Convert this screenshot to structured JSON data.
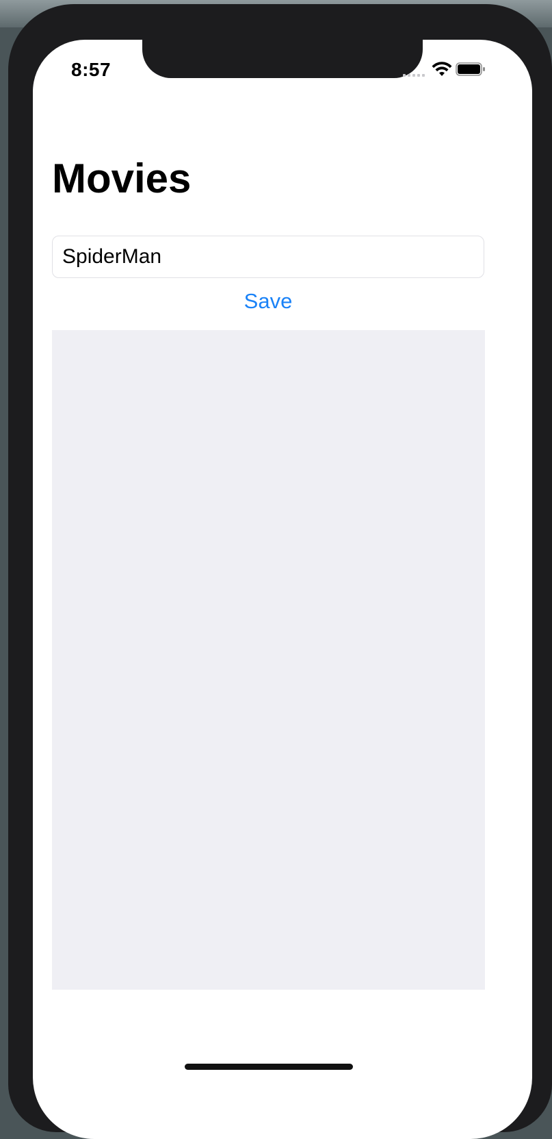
{
  "status_bar": {
    "time": "8:57",
    "icons": [
      "cellular-dots-icon",
      "wifi-icon",
      "battery-icon"
    ]
  },
  "nav": {
    "title": "Movies"
  },
  "form": {
    "movie_input_value": "SpiderMan",
    "save_label": "Save"
  },
  "list": {
    "items": []
  },
  "colors": {
    "accent": "#1a82f7",
    "list_background": "#efeff4",
    "frame": "#1c1c1e"
  }
}
